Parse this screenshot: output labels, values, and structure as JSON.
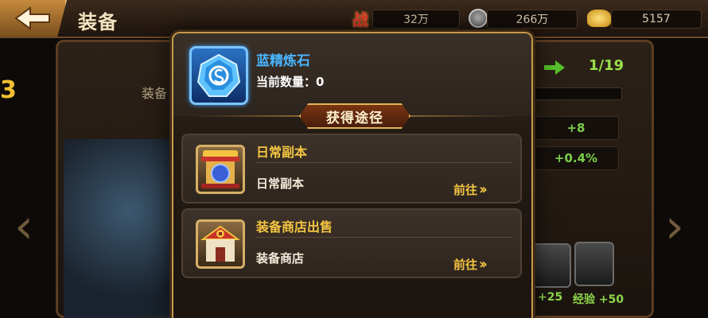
{
  "header": {
    "title": "装备",
    "resources": [
      {
        "icon": "battle-power-icon",
        "icon_text": "战",
        "value": "32万"
      },
      {
        "icon": "silver-coin-icon",
        "value": "266万"
      },
      {
        "icon": "gold-ingot-icon",
        "value": "5157"
      }
    ]
  },
  "background": {
    "equip_label": "装备",
    "left_number": "3",
    "progress": "1/19",
    "stat_values": [
      "+8",
      "+0.4%"
    ],
    "bonuses": [
      "+25",
      "经验 +50"
    ]
  },
  "modal": {
    "item": {
      "name": "蓝精炼石",
      "quantity_label": "当前数量：",
      "quantity_value": "0",
      "icon": "blue-refining-stone-icon"
    },
    "section_title": "获得途径",
    "sources": [
      {
        "title": "日常副本",
        "description": "日常副本",
        "go_label": "前往",
        "icon": "daily-dungeon-palace-icon"
      },
      {
        "title": "装备商店出售",
        "description": "装备商店",
        "go_label": "前往",
        "icon": "equipment-shop-icon"
      }
    ]
  },
  "colors": {
    "gold_text": "#f5c542",
    "item_blue": "#4ab6ff",
    "green_stat": "#7ad04b",
    "frame_border": "#c79a4a"
  }
}
